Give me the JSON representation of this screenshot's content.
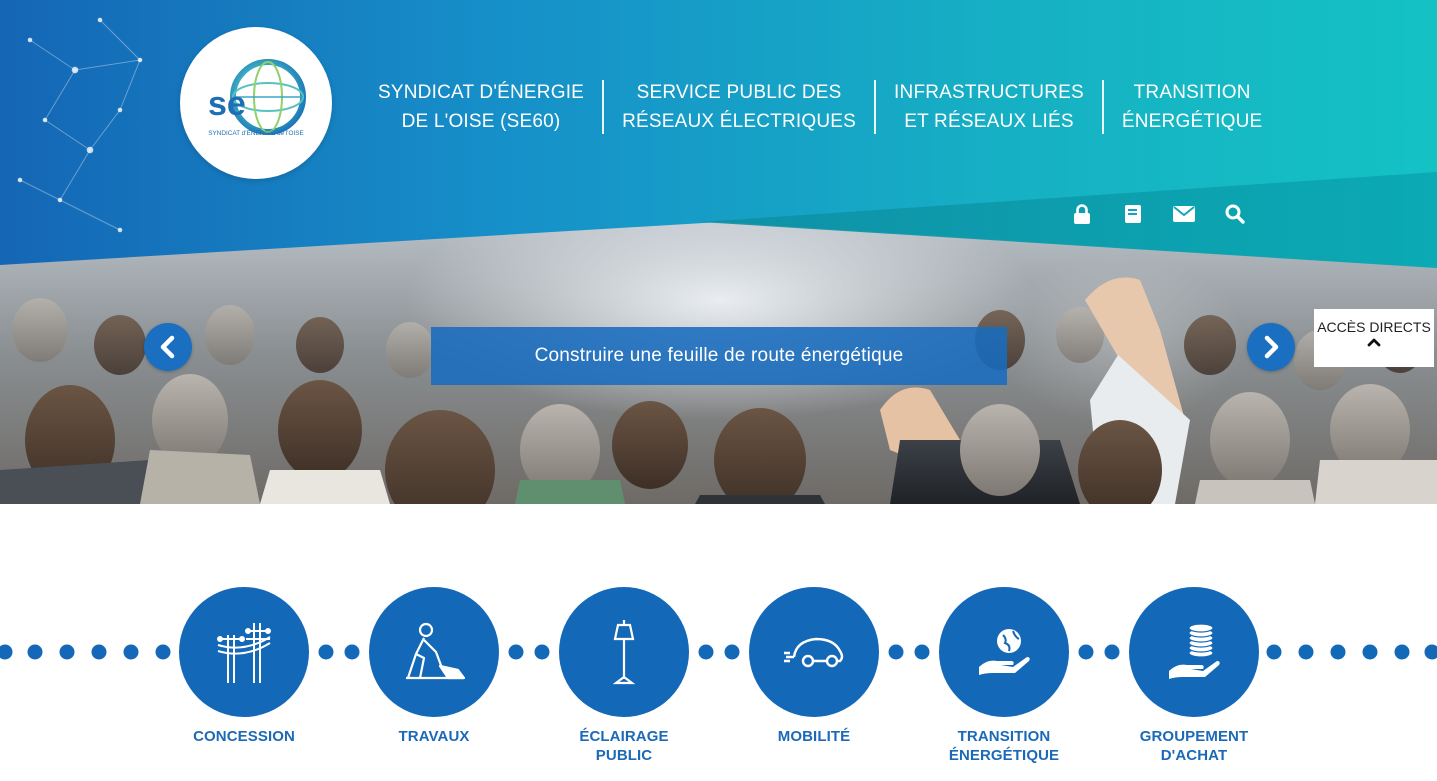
{
  "header": {
    "logo": {
      "text": "se60",
      "tagline": "SYNDICAT d'ENERGIE de l'OISE"
    },
    "nav": [
      {
        "line1": "SYNDICAT D'ÉNERGIE",
        "line2": "DE L'OISE (SE60)"
      },
      {
        "line1": "SERVICE PUBLIC DES",
        "line2": "RÉSEAUX ÉLECTRIQUES"
      },
      {
        "line1": "INFRASTRUCTURES",
        "line2": "ET RÉSEAUX LIÉS"
      },
      {
        "line1": "TRANSITION",
        "line2": "ÉNERGÉTIQUE"
      }
    ],
    "utility_icons": [
      "lock-icon",
      "book-icon",
      "envelope-icon",
      "search-icon"
    ]
  },
  "slider": {
    "caption": "Construire une feuille de route énergétique",
    "prev_icon": "chevron-left-icon",
    "next_icon": "chevron-right-icon"
  },
  "acces_directs": {
    "label": "ACCÈS DIRECTS",
    "icon": "chevron-up-icon"
  },
  "services": [
    {
      "line1": "CONCESSION",
      "line2": "",
      "icon": "power-line-icon"
    },
    {
      "line1": "TRAVAUX",
      "line2": "",
      "icon": "worker-digging-icon"
    },
    {
      "line1": "ÉCLAIRAGE",
      "line2": "PUBLIC",
      "icon": "street-lamp-icon"
    },
    {
      "line1": "MOBILITÉ",
      "line2": "",
      "icon": "electric-car-icon"
    },
    {
      "line1": "TRANSITION",
      "line2": "ÉNERGÉTIQUE",
      "icon": "globe-hand-icon"
    },
    {
      "line1": "GROUPEMENT",
      "line2": "D'ACHAT",
      "icon": "coins-hand-icon"
    }
  ],
  "colors": {
    "primary_blue": "#1468b8",
    "teal": "#17b3c2",
    "service_label": "#1c6ab7"
  }
}
